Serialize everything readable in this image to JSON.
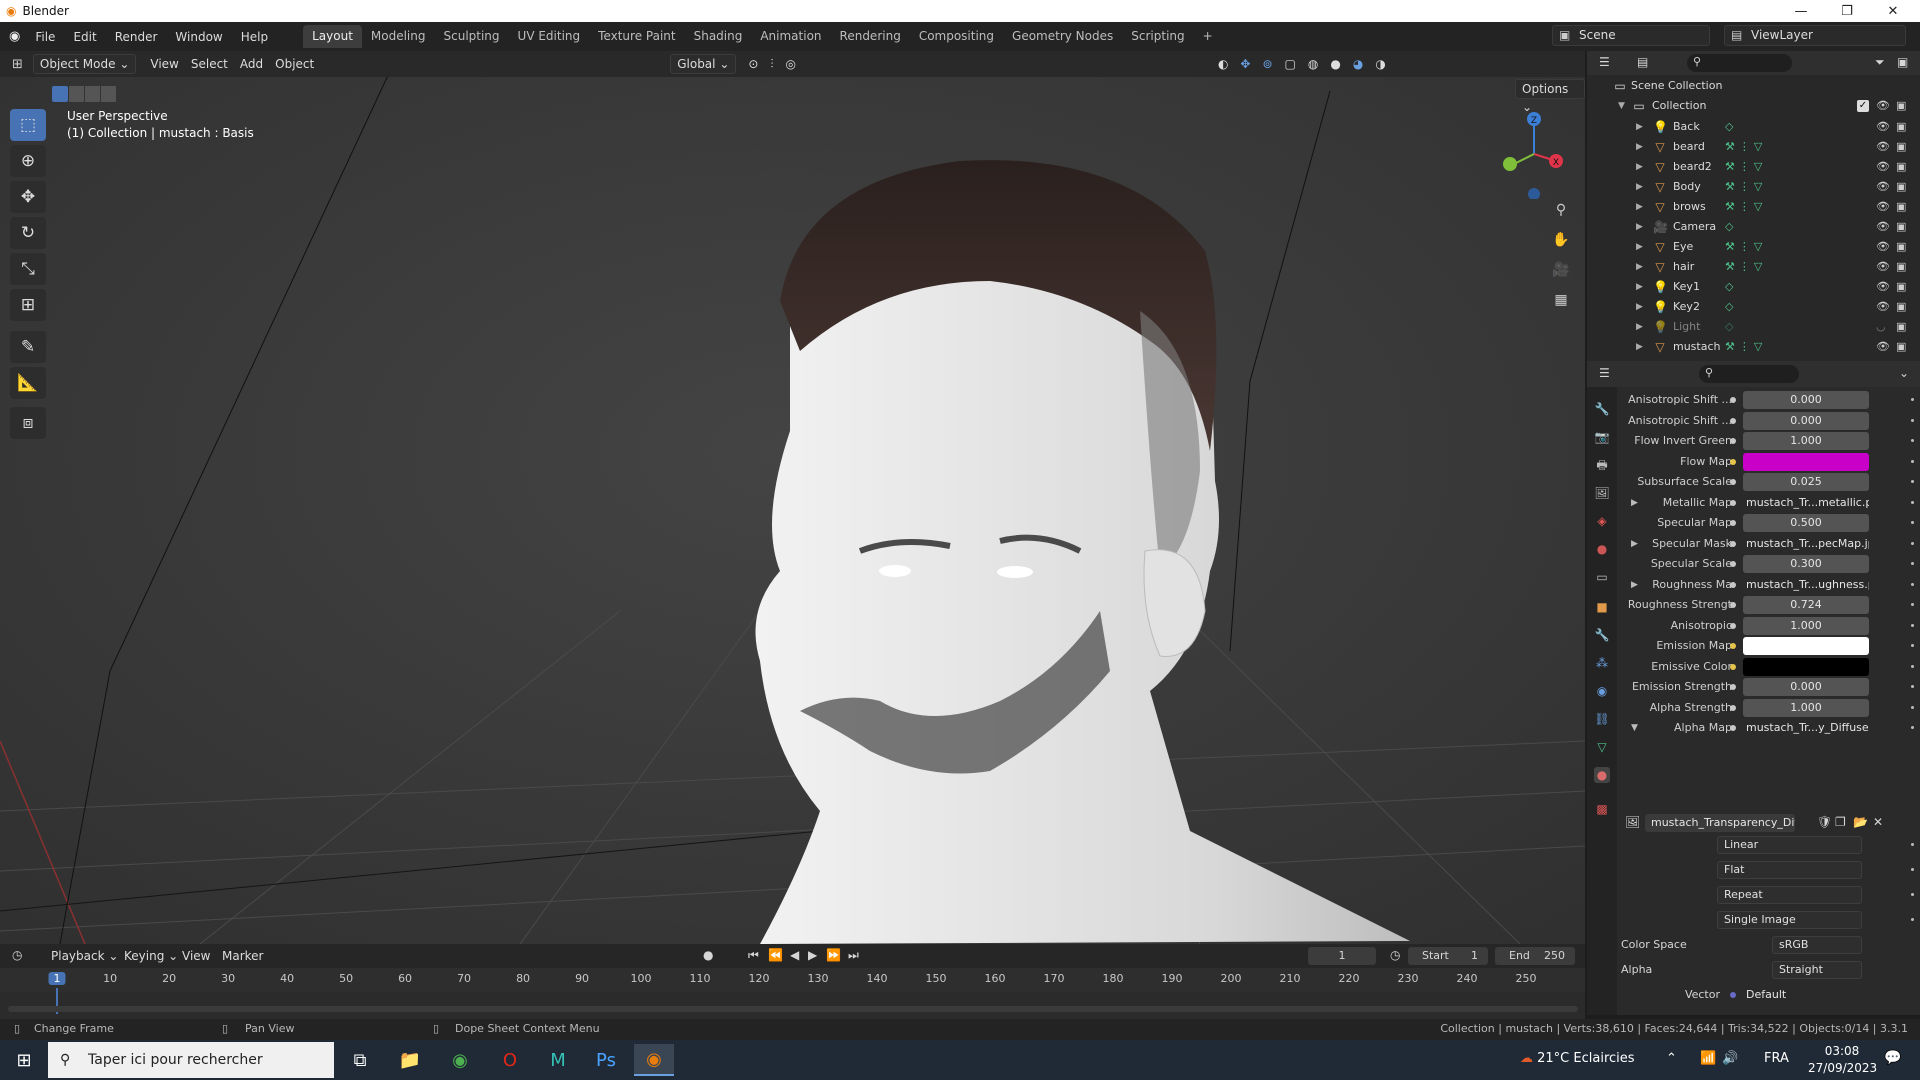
{
  "window": {
    "title": "Blender",
    "minimize": "—",
    "maximize": "❐",
    "close": "✕"
  },
  "menu": [
    "File",
    "Edit",
    "Render",
    "Window",
    "Help"
  ],
  "workspaces": [
    "Layout",
    "Modeling",
    "Sculpting",
    "UV Editing",
    "Texture Paint",
    "Shading",
    "Animation",
    "Rendering",
    "Compositing",
    "Geometry Nodes",
    "Scripting",
    "+"
  ],
  "active_workspace": "Layout",
  "scene": {
    "name": "Scene",
    "view_layer": "ViewLayer"
  },
  "viewport": {
    "mode": "Object Mode",
    "menus": [
      "View",
      "Select",
      "Add",
      "Object"
    ],
    "orientation": "Global",
    "options_label": "Options",
    "overlay_title": "User Perspective",
    "overlay_subtitle": "(1) Collection | mustach : Basis",
    "gizmo_axes": {
      "z": "Z",
      "x": "X"
    },
    "colors": {
      "x_axis": "#e0344b",
      "y_axis": "#7fbf3a",
      "z_axis": "#3c7fd6",
      "active_tool": "#4772b3"
    }
  },
  "outliner": {
    "root": "Scene Collection",
    "collection": "Collection",
    "items": [
      {
        "name": "Back",
        "icon": "light-icon"
      },
      {
        "name": "beard",
        "icon": "mesh-icon"
      },
      {
        "name": "beard2",
        "icon": "mesh-icon"
      },
      {
        "name": "Body",
        "icon": "mesh-icon"
      },
      {
        "name": "brows",
        "icon": "mesh-icon"
      },
      {
        "name": "Camera",
        "icon": "camera-icon"
      },
      {
        "name": "Eye",
        "icon": "mesh-icon"
      },
      {
        "name": "hair",
        "icon": "mesh-icon"
      },
      {
        "name": "Key1",
        "icon": "light-icon"
      },
      {
        "name": "Key2",
        "icon": "light-icon"
      },
      {
        "name": "Light",
        "icon": "light-icon"
      },
      {
        "name": "mustach",
        "icon": "mesh-icon"
      }
    ]
  },
  "properties": {
    "rows": [
      {
        "label": "Anisotropic Shift ...",
        "value": "0.000"
      },
      {
        "label": "Anisotropic Shift ...",
        "value": "0.000"
      },
      {
        "label": "Flow Invert Green",
        "value": "1.000"
      },
      {
        "label": "Flow Map",
        "value": "",
        "color": "#c800c8"
      },
      {
        "label": "Subsurface Scale",
        "value": "0.025"
      },
      {
        "label": "Metallic Map",
        "value": "mustach_Tr...metallic.pn",
        "text": true
      },
      {
        "label": "Specular Map",
        "value": "0.500"
      },
      {
        "label": "Specular Mask",
        "value": "mustach_Tr...pecMap.jpg",
        "text": true
      },
      {
        "label": "Specular Scale",
        "value": "0.300"
      },
      {
        "label": "Roughness Ma",
        "value": "mustach_Tr...ughness.pn",
        "text": true
      },
      {
        "label": "Roughness Strengt",
        "value": "0.724"
      },
      {
        "label": "Anisotropic",
        "value": "1.000"
      },
      {
        "label": "Emission Map",
        "value": "",
        "color": "#ffffff"
      },
      {
        "label": "Emissive Color",
        "value": "",
        "color": "#000000"
      },
      {
        "label": "Emission Strength",
        "value": "0.000"
      },
      {
        "label": "Alpha Strength",
        "value": "1.000"
      },
      {
        "label": "Alpha Map",
        "value": "mustach_Tr...y_Diffuse.tif",
        "text": true
      }
    ],
    "image_name": "mustach_Transparency_Diff...",
    "interpolation": "Linear",
    "projection": "Flat",
    "extension": "Repeat",
    "source": "Single Image",
    "color_space_label": "Color Space",
    "color_space": "sRGB",
    "alpha_label": "Alpha",
    "alpha": "Straight",
    "vector_label": "Vector",
    "vector": "Default"
  },
  "timeline": {
    "menus": [
      "Playback",
      "Keying",
      "View",
      "Marker"
    ],
    "current_frame": "1",
    "start_label": "Start",
    "start": "1",
    "end_label": "End",
    "end": "250",
    "ticks": [
      "1",
      "10",
      "20",
      "30",
      "40",
      "50",
      "60",
      "70",
      "80",
      "90",
      "100",
      "110",
      "120",
      "130",
      "140",
      "150",
      "160",
      "170",
      "180",
      "190",
      "200",
      "210",
      "220",
      "230",
      "240",
      "250"
    ]
  },
  "statusbar": {
    "left1": "Change Frame",
    "left2": "Pan View",
    "left3": "Dope Sheet Context Menu",
    "right": "Collection | mustach | Verts:38,610 | Faces:24,644 | Tris:34,522 | Objects:0/14 | 3.3.1"
  },
  "taskbar": {
    "search_placeholder": "Taper ici pour rechercher",
    "weather": "21°C  Eclaircies",
    "language": "FRA",
    "time": "03:08",
    "date": "27/09/2023"
  }
}
